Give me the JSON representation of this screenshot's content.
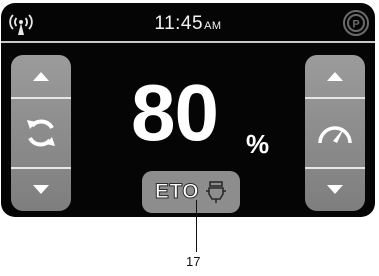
{
  "status_bar": {
    "time": "11:45",
    "ampm": "AM",
    "icons": [
      "signal-icon",
      "park-brake-icon"
    ]
  },
  "left_panel": {
    "icons": [
      "up-arrow-icon",
      "rotate-icon",
      "down-arrow-icon"
    ]
  },
  "right_panel": {
    "icons": [
      "up-arrow-icon",
      "speedometer-icon",
      "down-arrow-icon"
    ]
  },
  "main_readout": {
    "value": "80",
    "unit": "%"
  },
  "eto_button": {
    "label": "ETO",
    "icon": "engine-icon"
  },
  "callout": {
    "label": "17"
  },
  "colors": {
    "screen_bg": "#050505",
    "panel_bg": "#8a8a8a",
    "text": "#ffffff"
  }
}
